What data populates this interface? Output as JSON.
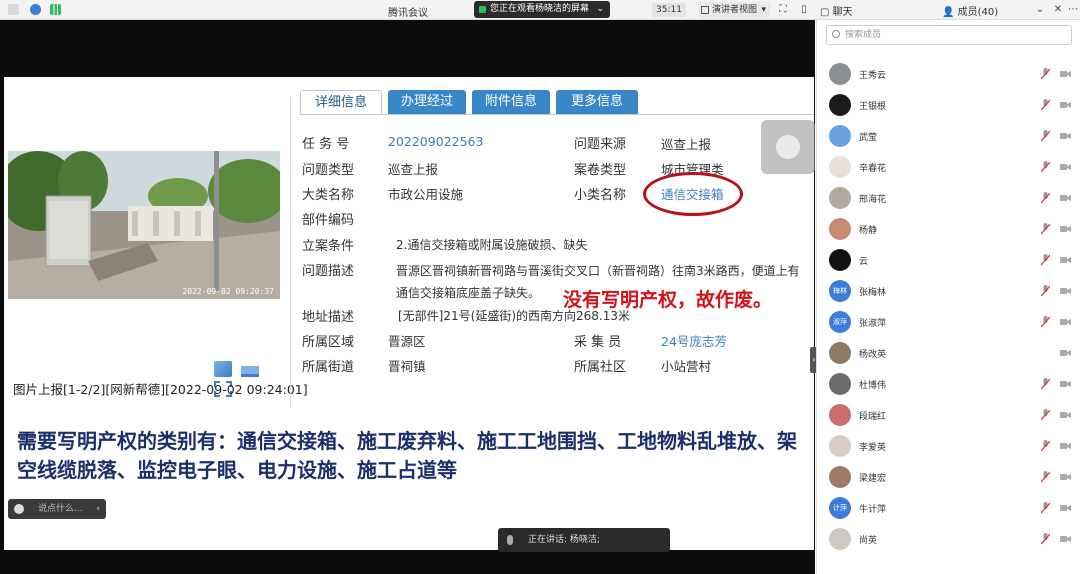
{
  "topbar": {
    "app_title": "腾讯会议",
    "share_notice": "您正在观看杨晓洁的屏幕",
    "timer": "35:11",
    "view_mode": "演讲者视图",
    "chat_tab": "聊天",
    "members_tab": "成员(40)"
  },
  "slide": {
    "tabs": [
      "详细信息",
      "办理经过",
      "附件信息",
      "更多信息"
    ],
    "photo_stamp": "2022-09-02 09:20:37",
    "image_caption": "图片上报[1-2/2][网新帮德][2022-09-02 09:24:01]",
    "fields": {
      "task_no_label": "任 务 号",
      "task_no": "202209022563",
      "source_label": "问题来源",
      "source": "巡查上报",
      "type_label": "问题类型",
      "type": "巡查上报",
      "case_type_label": "案卷类型",
      "case_type": "城市管理类",
      "major_label": "大类名称",
      "major": "市政公用设施",
      "minor_label": "小类名称",
      "minor": "通信交接箱",
      "component_label": "部件编码",
      "filing_label": "立案条件",
      "filing": "2.通信交接箱或附属设施破损、缺失",
      "desc_label": "问题描述",
      "desc": "晋源区晋祠镇新晋祠路与晋溪街交叉口（新晋祠路）往南3米路西，便道上有通信交接箱底座盖子缺失。",
      "address_label": "地址描述",
      "address": "[无部件]21号(延盛街)的西南方向268.13米",
      "district_label": "所属区域",
      "district": "晋源区",
      "collector_label": "采 集 员",
      "collector": "24号庞志芳",
      "street_label": "所属街道",
      "street": "晋祠镇",
      "community_label": "所属社区",
      "community": "小站营村"
    },
    "red_annotation": "没有写明产权，故作废。",
    "big_text": "需要写明产权的类别有：通信交接箱、施工废弃料、施工工地围挡、工地物料乱堆放、架空线缆脱落、监控电子眼、电力设施、施工占道等"
  },
  "chat_input_placeholder": "说点什么...",
  "speaking_label": "正在讲话: 杨晓洁;",
  "members": {
    "search_placeholder": "搜索成员",
    "list": [
      {
        "name": "王秀云",
        "avatar_color": "#8a8f96",
        "avatar_text": ""
      },
      {
        "name": "王银根",
        "avatar_color": "#1c1c1c",
        "avatar_text": ""
      },
      {
        "name": "武莹",
        "avatar_color": "#6aa0e0",
        "avatar_text": ""
      },
      {
        "name": "辛春花",
        "avatar_color": "#e8e0d8",
        "avatar_text": ""
      },
      {
        "name": "邢海花",
        "avatar_color": "#b2a8a0",
        "avatar_text": ""
      },
      {
        "name": "杨静",
        "avatar_color": "#c98a74",
        "avatar_text": ""
      },
      {
        "name": "云",
        "avatar_color": "#111111",
        "avatar_text": ""
      },
      {
        "name": "张梅林",
        "avatar_color": "#3b7dd8",
        "avatar_text": "梅林"
      },
      {
        "name": "张淑萍",
        "avatar_color": "#3b7dd8",
        "avatar_text": "淑萍"
      },
      {
        "name": "杨改英",
        "avatar_color": "#8c7a62",
        "avatar_text": ""
      },
      {
        "name": "杜博伟",
        "avatar_color": "#6b6b6b",
        "avatar_text": ""
      },
      {
        "name": "段瑞红",
        "avatar_color": "#c86c6c",
        "avatar_text": ""
      },
      {
        "name": "李爱英",
        "avatar_color": "#d8cfc4",
        "avatar_text": ""
      },
      {
        "name": "梁建宏",
        "avatar_color": "#a07a66",
        "avatar_text": ""
      },
      {
        "name": "牛计萍",
        "avatar_color": "#3b7dd8",
        "avatar_text": "计萍"
      },
      {
        "name": "尚英",
        "avatar_color": "#d0c8c0",
        "avatar_text": ""
      }
    ]
  },
  "colors": {
    "accent_blue": "#3a87c8",
    "link_blue": "#3b7dc4",
    "annotation_red": "#d3121a",
    "headline_navy": "#1c2f6b"
  }
}
